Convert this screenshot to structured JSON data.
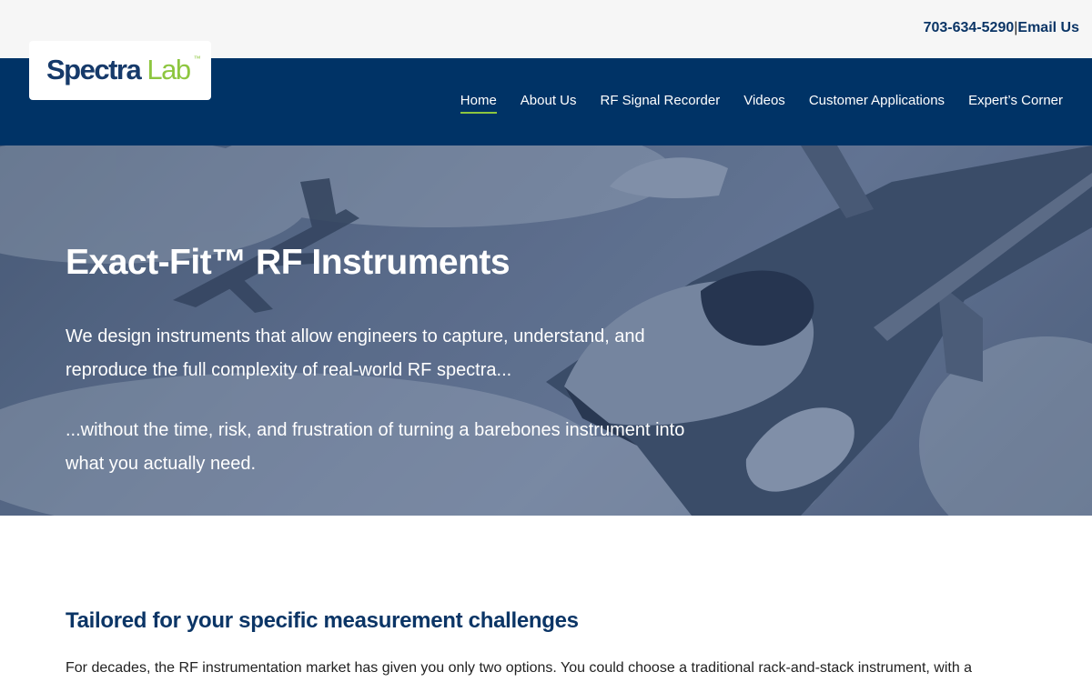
{
  "contact": {
    "phone": "703-634-5290",
    "separator": "|",
    "email_label": "Email Us"
  },
  "logo": {
    "word1": "Spectra",
    "word2": "Lab",
    "trademark": "™"
  },
  "nav": {
    "items": [
      {
        "label": "Home",
        "active": true
      },
      {
        "label": "About Us"
      },
      {
        "label": "RF Signal Recorder"
      },
      {
        "label": "Videos"
      },
      {
        "label": "Customer Applications"
      },
      {
        "label": "Expert’s Corner"
      }
    ]
  },
  "hero": {
    "title": "Exact-Fit™ RF Instruments",
    "paragraph1": "We design instruments that allow engineers to capture, understand, and reproduce the full complexity of real-world RF spectra...",
    "paragraph2": "...without the time, risk, and frustration of turning a barebones instrument into what you actually need.",
    "image": "fighter-jets-in-clouds"
  },
  "section": {
    "title": "Tailored for your specific measurement challenges",
    "body": "For decades, the RF instrumentation market has given you only two options. You could choose a traditional rack-and-stack instrument, with a"
  },
  "colors": {
    "navy": "#003366",
    "accent_green": "#8dc63f",
    "heading_blue": "#0b3566",
    "topbar": "#f6f6f6"
  }
}
